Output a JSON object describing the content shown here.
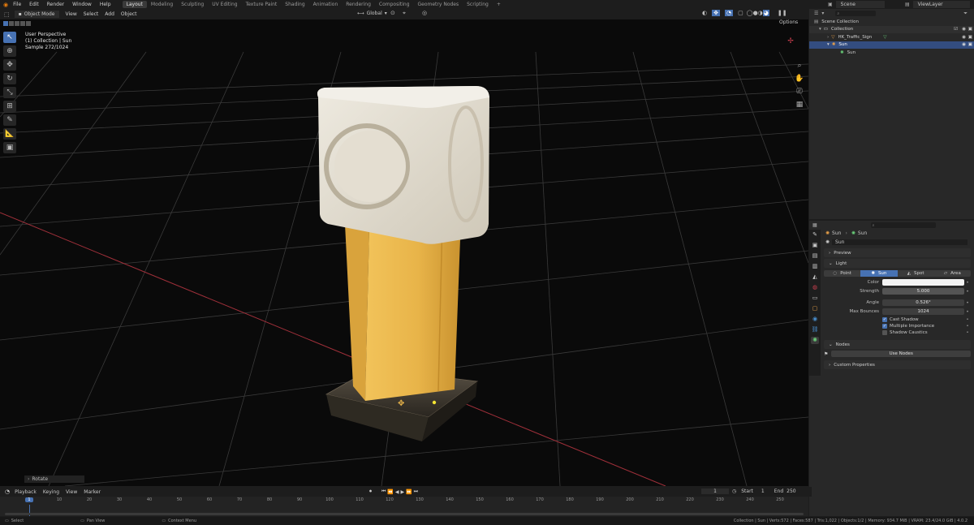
{
  "app": {
    "logo_icon": "blender-icon"
  },
  "menu": [
    "File",
    "Edit",
    "Render",
    "Window",
    "Help"
  ],
  "workspaces": [
    {
      "label": "Layout",
      "active": true
    },
    {
      "label": "Modeling"
    },
    {
      "label": "Sculpting"
    },
    {
      "label": "UV Editing"
    },
    {
      "label": "Texture Paint"
    },
    {
      "label": "Shading"
    },
    {
      "label": "Animation"
    },
    {
      "label": "Rendering"
    },
    {
      "label": "Compositing"
    },
    {
      "label": "Geometry Nodes"
    },
    {
      "label": "Scripting"
    }
  ],
  "scene": {
    "name": "Scene",
    "view_layer": "ViewLayer"
  },
  "viewport_header": {
    "mode": "Object Mode",
    "menus": [
      "View",
      "Select",
      "Add",
      "Object"
    ],
    "orientation": "Global",
    "options": "Options"
  },
  "viewport_overlay": {
    "line1": "User Perspective",
    "line2": "(1) Collection | Sun",
    "line3": "Sample 272/1024"
  },
  "operator_panel": {
    "label": "Rotate"
  },
  "outliner": {
    "root": "Scene Collection",
    "rows": [
      {
        "label": "Collection",
        "indent": 1
      },
      {
        "label": "HK_Traffic_Sign",
        "indent": 2
      },
      {
        "label": "Sun",
        "indent": 2,
        "selected": true
      },
      {
        "label": "Sun",
        "indent": 3
      }
    ]
  },
  "properties": {
    "breadcrumb_a": "Sun",
    "breadcrumb_b": "Sun",
    "datablock": "Sun",
    "preview_panel": "Preview",
    "light_panel": "Light",
    "light_types": [
      {
        "label": "Point"
      },
      {
        "label": "Sun",
        "active": true
      },
      {
        "label": "Spot"
      },
      {
        "label": "Area"
      }
    ],
    "fields": [
      {
        "label": "Color",
        "value": ""
      },
      {
        "label": "Strength",
        "value": "5.000"
      },
      {
        "label": "Angle",
        "value": "0.526°"
      },
      {
        "label": "Max Bounces",
        "value": "1024"
      }
    ],
    "checkboxes": [
      {
        "label": "Cast Shadow",
        "checked": true
      },
      {
        "label": "Multiple Importance",
        "checked": true
      },
      {
        "label": "Shadow Caustics",
        "checked": false
      }
    ],
    "nodes_panel": "Nodes",
    "use_nodes": "Use Nodes",
    "custom_props": "Custom Properties"
  },
  "timeline": {
    "menus": [
      "Playback",
      "Keying",
      "View",
      "Marker"
    ],
    "current_frame": "1",
    "start_label": "Start",
    "start": "1",
    "end_label": "End",
    "end": "250",
    "ticks": [
      "1",
      "10",
      "20",
      "30",
      "40",
      "50",
      "60",
      "70",
      "80",
      "90",
      "100",
      "110",
      "120",
      "130",
      "140",
      "150",
      "160",
      "170",
      "180",
      "190",
      "200",
      "210",
      "220",
      "230",
      "240",
      "250"
    ]
  },
  "statusbar": {
    "select": "Select",
    "pan": "Pan View",
    "context": "Context Menu",
    "stats": "Collection | Sun | Verts:572 | Faces:587 | Tris:1,022 | Objects:1/2 | Memory: 934.7 MiB | VRAM: 23.4/24.0 GiB | 4.0.2"
  },
  "colors": {
    "accent": "#4772b3",
    "selection": "#334d80",
    "grid": "#3a3a3a",
    "x_axis": "#a0303a",
    "post": "#e8b24a",
    "cube": "#e6e0d4"
  }
}
